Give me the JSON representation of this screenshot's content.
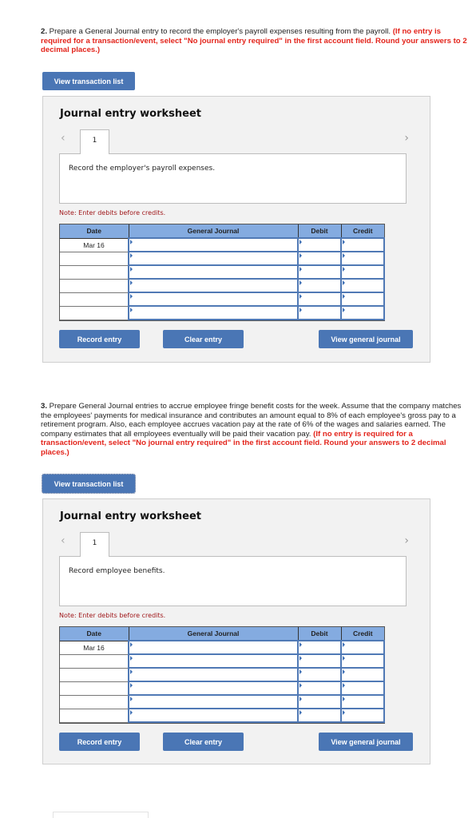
{
  "questions": [
    {
      "number": "2.",
      "text": " Prepare a General Journal entry to record the employer's payroll expenses resulting from the payroll. ",
      "instruction": "(If no entry is required for a transaction/event, select \"No journal entry required\" in the first account field. Round your answers to 2 decimal places.)",
      "view_transaction_label": "View transaction list",
      "worksheet": {
        "title": "Journal entry worksheet",
        "prev_icon": "chevron-left-icon",
        "next_icon": "chevron-right-icon",
        "tab_label": "1",
        "description": "Record the employer's payroll expenses.",
        "note": "Note: Enter debits before credits.",
        "columns": [
          "Date",
          "General Journal",
          "Debit",
          "Credit"
        ],
        "rows": [
          {
            "date": "Mar 16",
            "account": "",
            "debit": "",
            "credit": ""
          },
          {
            "date": "",
            "account": "",
            "debit": "",
            "credit": ""
          },
          {
            "date": "",
            "account": "",
            "debit": "",
            "credit": ""
          },
          {
            "date": "",
            "account": "",
            "debit": "",
            "credit": ""
          },
          {
            "date": "",
            "account": "",
            "debit": "",
            "credit": ""
          },
          {
            "date": "",
            "account": "",
            "debit": "",
            "credit": ""
          }
        ],
        "record_label": "Record entry",
        "clear_label": "Clear entry",
        "view_journal_label": "View general journal"
      }
    },
    {
      "number": "3.",
      "text": " Prepare General Journal entries to accrue employee fringe benefit costs for the week. Assume that the company matches the employees' payments for medical insurance and contributes an amount equal to 8% of each employee's gross pay to a retirement program. Also, each employee accrues vacation pay at the rate of 6% of the wages and salaries earned. The company estimates that all employees eventually will be paid their vacation pay. ",
      "instruction": "(If no entry is required for a transaction/event, select \"No journal entry required\" in the first account field. Round your answers to 2 decimal places.)",
      "view_transaction_label": "View transaction list",
      "worksheet": {
        "title": "Journal entry worksheet",
        "prev_icon": "chevron-left-icon",
        "next_icon": "chevron-right-icon",
        "tab_label": "1",
        "description": "Record employee benefits.",
        "note": "Note: Enter debits before credits.",
        "columns": [
          "Date",
          "General Journal",
          "Debit",
          "Credit"
        ],
        "rows": [
          {
            "date": "Mar 16",
            "account": "",
            "debit": "",
            "credit": ""
          },
          {
            "date": "",
            "account": "",
            "debit": "",
            "credit": ""
          },
          {
            "date": "",
            "account": "",
            "debit": "",
            "credit": ""
          },
          {
            "date": "",
            "account": "",
            "debit": "",
            "credit": ""
          },
          {
            "date": "",
            "account": "",
            "debit": "",
            "credit": ""
          },
          {
            "date": "",
            "account": "",
            "debit": "",
            "credit": ""
          }
        ],
        "record_label": "Record entry",
        "clear_label": "Clear entry",
        "view_journal_label": "View general journal"
      }
    }
  ],
  "colors": {
    "button": "#4a76b5",
    "table_header": "#84abe0",
    "instruction_red": "#e3241b",
    "note_red": "#a0181b",
    "worksheet_bg": "#f2f2f2"
  }
}
